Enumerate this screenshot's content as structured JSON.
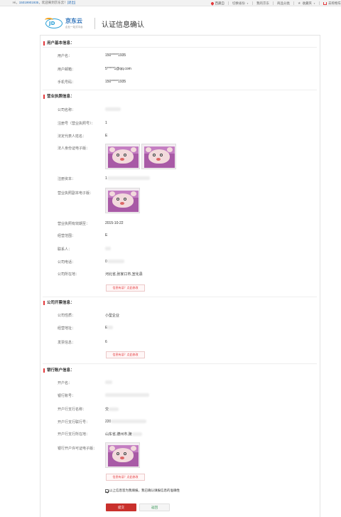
{
  "topbar": {
    "greeting_prefix": "Hi，",
    "username": "15019901935",
    "greeting_suffix": "，欢迎来到京东云！",
    "logout": "[退出]",
    "location": "西藏自",
    "switch_region": "切换省份",
    "my_center": "我的京东",
    "categories": "商品分类",
    "favorites": "收藏夹",
    "cart": "去购物车"
  },
  "header": {
    "logo_mark": "JD",
    "logo_text": "京东云",
    "logo_sub": "企业一站式平台",
    "page_title": "认证信息确认"
  },
  "basic": {
    "title": "用户基本信息：",
    "fields": [
      {
        "label": "用户名：",
        "value": "150*****1935"
      },
      {
        "label": "用户邮箱：",
        "value": "5*****1@qq.com"
      },
      {
        "label": "手机号码：",
        "value": "150*****1935"
      }
    ]
  },
  "license": {
    "title": "营业执照信息：",
    "fields": [
      {
        "label": "公司名称：",
        "value": ""
      },
      {
        "label": "注册号（营业执照号）：",
        "value": "1"
      },
      {
        "label": "法定代表人姓名：",
        "value": "E"
      },
      {
        "label": "法人身份证电子版：",
        "value": ""
      },
      {
        "label": "注册资本：",
        "value": "1"
      },
      {
        "label": "营业执照副本电子版：",
        "value": ""
      },
      {
        "label": "营业执照有效期至：",
        "value": "2015-10-22"
      },
      {
        "label": "经营范围：",
        "value": "E"
      },
      {
        "label": "联系人：",
        "value": ""
      },
      {
        "label": "公司电话：",
        "value": "0"
      },
      {
        "label": "公司所在地：",
        "value": "河北省,张家口市,宣化县"
      }
    ],
    "edit_button": "信息有误？点此修改"
  },
  "tax": {
    "title": "公司开票信息：",
    "fields": [
      {
        "label": "公司性质：",
        "value": "小型企业"
      },
      {
        "label": "经营地址：",
        "value": "E"
      },
      {
        "label": "发票信息：",
        "value": "6"
      }
    ],
    "edit_button": "信息有误？点此修改"
  },
  "bank": {
    "title": "银行账户信息：",
    "fields": [
      {
        "label": "开户名：",
        "value": ""
      },
      {
        "label": "银行账号：",
        "value": ""
      },
      {
        "label": "开户行支行名称：",
        "value": "交"
      },
      {
        "label": "开户行支行联行号：",
        "value": "220"
      },
      {
        "label": "开户行支行所在地：",
        "value": "山东省,德州市,陵"
      },
      {
        "label": "银行开户许可证电子版：",
        "value": ""
      }
    ],
    "edit_button": "信息有误？点此修改"
  },
  "agreement": {
    "text": "以上信息皆为我填报，我已确认填报信息的准确性"
  },
  "actions": {
    "submit": "提交",
    "back": "返回"
  },
  "colors": {
    "accent": "#e4393c",
    "link": "#2a6fb8",
    "submit_bg": "#c9302c"
  }
}
